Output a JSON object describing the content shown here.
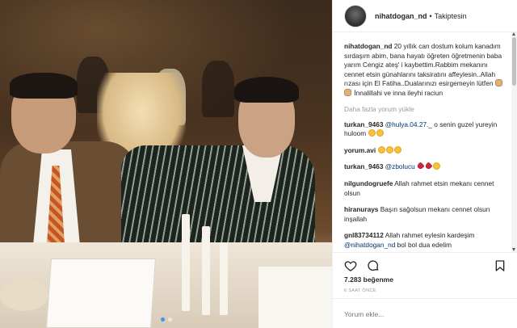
{
  "post": {
    "username": "nihatdogan_nd",
    "separator": "•",
    "follow_status": "Takiptesin"
  },
  "caption": {
    "username": "nihatdogan_nd",
    "text": "20 yıllık can dostum kolum kanadım sırdaşım abim, bana hayatı öğreten öğretmenin baba yarım Cengiz ateş' i kaybettim.Rabbim mekanını cennet etsin günahlarını taksiratını affeylesin..Allah rızası için El Fatiha..Dualarınızı esirgemeyin lütfen",
    "text_tail": "İnnalillahi ve inna ileyhi raciun"
  },
  "load_more": "Daha fazla yorum yükle",
  "comments": [
    {
      "username": "turkan_9463",
      "mention": "@hulya.04.27._",
      "text": " o senin guzel yureyin huloom"
    },
    {
      "username": "yorum.avi",
      "text": ""
    },
    {
      "username": "turkan_9463",
      "mention": "@zbolucu",
      "text": ""
    },
    {
      "username": "nilgundogruefe",
      "text": "Allah rahmet etsin mekanı cennet olsun"
    },
    {
      "username": "hiranurays",
      "text": "Başın sağolsun mekanı cennet olsun inşallah"
    },
    {
      "username": "gnl83734112",
      "text": "Allah rahmet eylesin kardeşim",
      "mention": "@nihatdogan_nd",
      "text_after": "bol bol dua edelim"
    }
  ],
  "likes": "7.283 beğenme",
  "time_ago": "6 SAAT ÖNCE",
  "add_comment_placeholder": "Yorum ekle...",
  "icons": {
    "like": "heart-icon",
    "comment": "speech-bubble-icon",
    "save": "bookmark-icon"
  },
  "colors": {
    "link": "#003569",
    "muted": "#999999",
    "text": "#262626"
  }
}
